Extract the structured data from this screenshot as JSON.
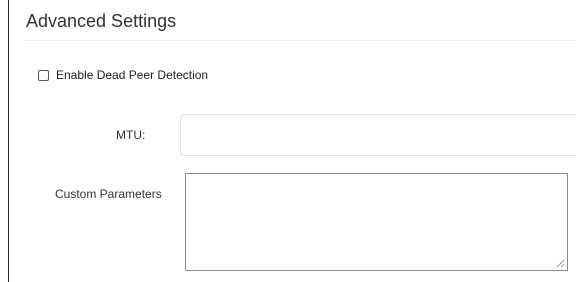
{
  "section": {
    "title": "Advanced Settings"
  },
  "dead_peer_detection": {
    "label": "Enable Dead Peer Detection",
    "checked": false
  },
  "mtu": {
    "label": "MTU:",
    "value": ""
  },
  "custom_parameters": {
    "label": "Custom Parameters",
    "value": ""
  },
  "icons": {
    "resize_grip": "resize-grip-icon"
  }
}
